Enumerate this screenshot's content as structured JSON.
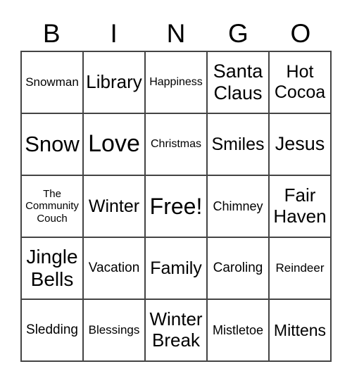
{
  "header": [
    "B",
    "I",
    "N",
    "G",
    "O"
  ],
  "cells": [
    "Snowman",
    "Library",
    "Happiness",
    "Santa\nClaus",
    "Hot\nCocoa",
    "Snow",
    "Love",
    "Christmas",
    "Smiles",
    "Jesus",
    "The\nCommunity\nCouch",
    "Winter",
    "Free!",
    "Chimney",
    "Fair\nHaven",
    "Jingle\nBells",
    "Vacation",
    "Family",
    "Caroling",
    "Reindeer",
    "Sledding",
    "Blessings",
    "Winter\nBreak",
    "Mistletoe",
    "Mittens"
  ]
}
